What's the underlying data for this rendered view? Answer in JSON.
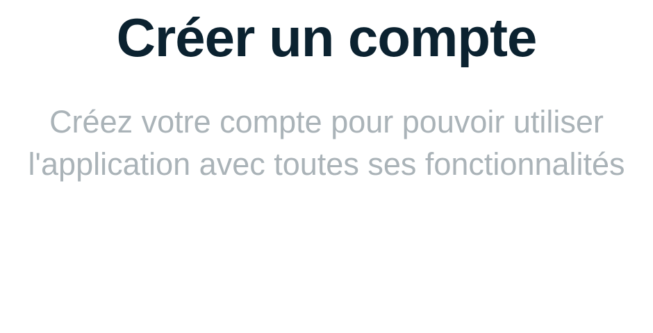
{
  "header": {
    "title": "Créer un compte"
  },
  "intro": {
    "line1": "Créez votre compte pour pouvoir utiliser",
    "line2": "l'application avec toutes ses fonctionnalités"
  },
  "colors": {
    "title_text": "#0b2230",
    "subtitle_text": "#aab3b8",
    "background": "#ffffff"
  }
}
